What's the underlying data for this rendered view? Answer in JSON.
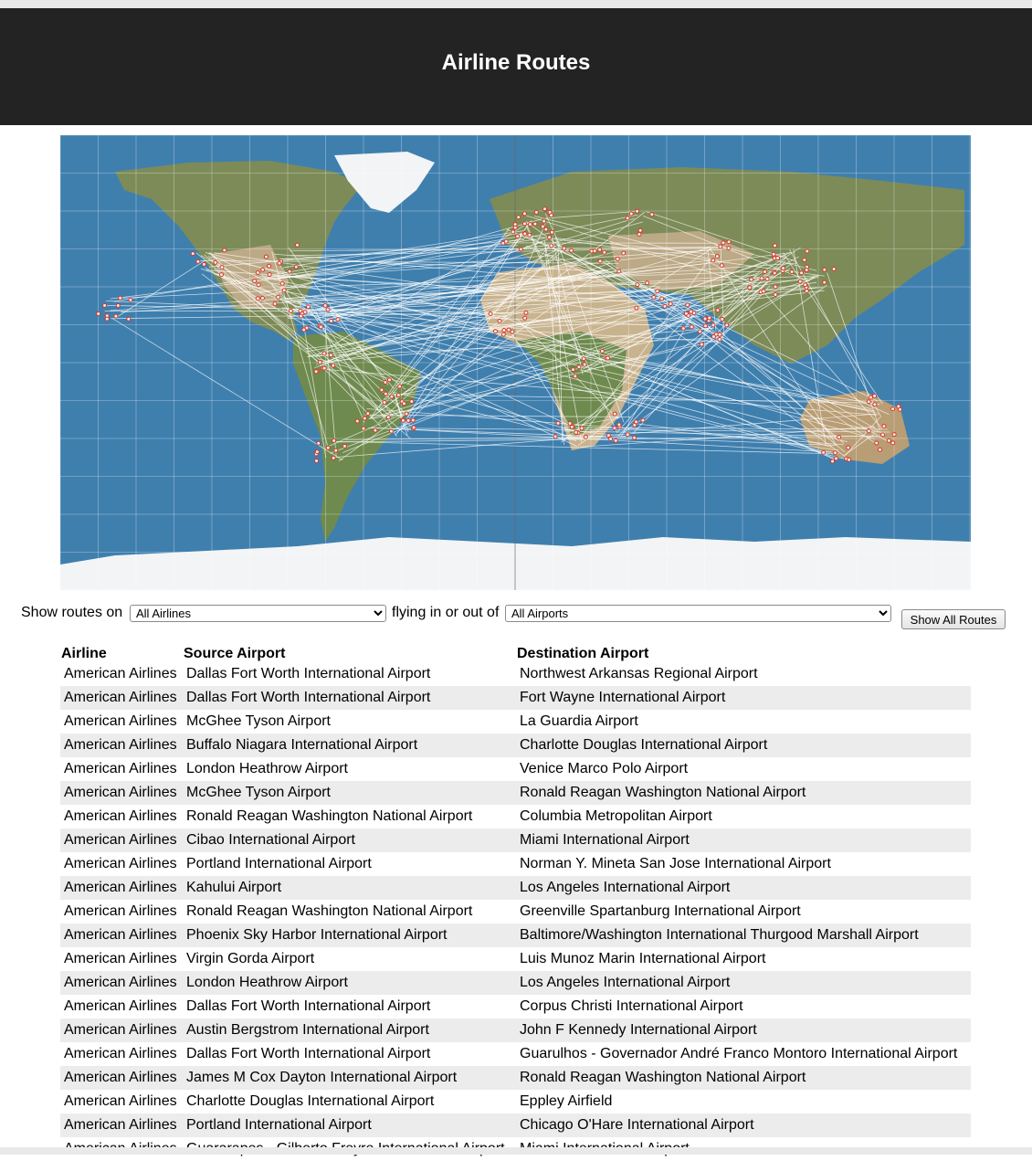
{
  "page": {
    "title": "Airline Routes"
  },
  "map": {
    "colors": {
      "ocean": "#3f7fae",
      "land": "#7d8b58",
      "desert": "#c8b38e",
      "ice": "#f2f4f6",
      "route": "#ffffff",
      "airport": "#d9362a"
    }
  },
  "controls": {
    "show_routes_label": "Show routes on",
    "airline_select": {
      "selected": "All Airlines"
    },
    "flying_label": "flying in or out of",
    "airport_select": {
      "selected": "All Airports"
    },
    "show_all_button": "Show All Routes"
  },
  "table": {
    "headers": {
      "airline": "Airline",
      "source": "Source Airport",
      "destination": "Destination Airport"
    },
    "rows": [
      {
        "airline": "American Airlines",
        "source": "Dallas Fort Worth International Airport",
        "destination": "Northwest Arkansas Regional Airport"
      },
      {
        "airline": "American Airlines",
        "source": "Dallas Fort Worth International Airport",
        "destination": "Fort Wayne International Airport"
      },
      {
        "airline": "American Airlines",
        "source": "McGhee Tyson Airport",
        "destination": "La Guardia Airport"
      },
      {
        "airline": "American Airlines",
        "source": "Buffalo Niagara International Airport",
        "destination": "Charlotte Douglas International Airport"
      },
      {
        "airline": "American Airlines",
        "source": "London Heathrow Airport",
        "destination": "Venice Marco Polo Airport"
      },
      {
        "airline": "American Airlines",
        "source": "McGhee Tyson Airport",
        "destination": "Ronald Reagan Washington National Airport"
      },
      {
        "airline": "American Airlines",
        "source": "Ronald Reagan Washington National Airport",
        "destination": "Columbia Metropolitan Airport"
      },
      {
        "airline": "American Airlines",
        "source": "Cibao International Airport",
        "destination": "Miami International Airport"
      },
      {
        "airline": "American Airlines",
        "source": "Portland International Airport",
        "destination": "Norman Y. Mineta San Jose International Airport"
      },
      {
        "airline": "American Airlines",
        "source": "Kahului Airport",
        "destination": "Los Angeles International Airport"
      },
      {
        "airline": "American Airlines",
        "source": "Ronald Reagan Washington National Airport",
        "destination": "Greenville Spartanburg International Airport"
      },
      {
        "airline": "American Airlines",
        "source": "Phoenix Sky Harbor International Airport",
        "destination": "Baltimore/Washington International Thurgood Marshall Airport"
      },
      {
        "airline": "American Airlines",
        "source": "Virgin Gorda Airport",
        "destination": "Luis Munoz Marin International Airport"
      },
      {
        "airline": "American Airlines",
        "source": "London Heathrow Airport",
        "destination": "Los Angeles International Airport"
      },
      {
        "airline": "American Airlines",
        "source": "Dallas Fort Worth International Airport",
        "destination": "Corpus Christi International Airport"
      },
      {
        "airline": "American Airlines",
        "source": "Austin Bergstrom International Airport",
        "destination": "John F Kennedy International Airport"
      },
      {
        "airline": "American Airlines",
        "source": "Dallas Fort Worth International Airport",
        "destination": "Guarulhos - Governador André Franco Montoro International Airport"
      },
      {
        "airline": "American Airlines",
        "source": "James M Cox Dayton International Airport",
        "destination": "Ronald Reagan Washington National Airport"
      },
      {
        "airline": "American Airlines",
        "source": "Charlotte Douglas International Airport",
        "destination": "Eppley Airfield"
      },
      {
        "airline": "American Airlines",
        "source": "Portland International Airport",
        "destination": "Chicago O'Hare International Airport"
      },
      {
        "airline": "American Airlines",
        "source": "Guararapes - Gilberto Freyre International Airport",
        "destination": "Miami International Airport"
      }
    ]
  }
}
